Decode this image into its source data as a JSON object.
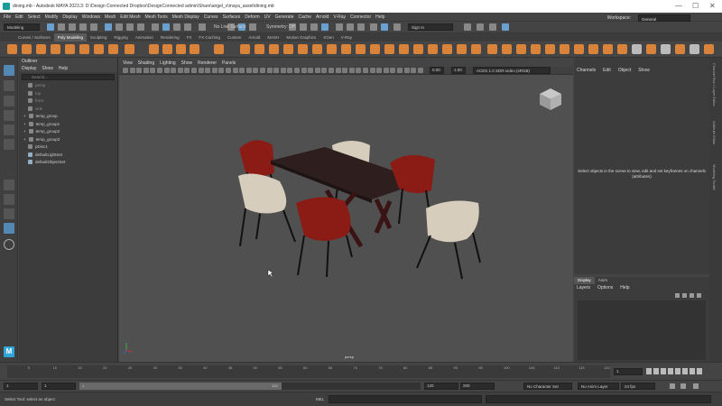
{
  "window": {
    "title": "dining.mb - Autodesk MAYA 2023.3: D:\\Design Connected Dropbox\\DesignConnected admin\\Share\\angel_v\\maya_asset\\dining.mb",
    "minimize": "—",
    "maximize": "☐",
    "close": "✕"
  },
  "menubar": {
    "items": [
      "File",
      "Edit",
      "Select",
      "Modify",
      "Display",
      "Windows",
      "Mesh",
      "Edit Mesh",
      "Mesh Tools",
      "Mesh Display",
      "Curves",
      "Surfaces",
      "Deform",
      "UV",
      "Generate",
      "Cache",
      "Arnold",
      "V-Ray",
      "Connector",
      "Help"
    ],
    "workspace_label": "Workspace:",
    "workspace_value": "General"
  },
  "statusline": {
    "mode": "Modeling",
    "live_surface": "No Live Surface",
    "symmetry": "Symmetry: Off",
    "sign_in": "Sign In"
  },
  "shelf": {
    "tabs": [
      "Curves / Surfaces",
      "Poly Modeling",
      "Sculpting",
      "Rigging",
      "Animation",
      "Rendering",
      "FX",
      "FX Caching",
      "Custom",
      "Arnold",
      "MASH",
      "Motion Graphics",
      "XGen",
      "V-Ray"
    ],
    "active_tab": "Poly Modeling"
  },
  "outliner": {
    "title": "Outliner",
    "menu": [
      "Display",
      "Show",
      "Help"
    ],
    "search_placeholder": "Search...",
    "items": [
      {
        "label": "persp",
        "dim": true
      },
      {
        "label": "top",
        "dim": true
      },
      {
        "label": "front",
        "dim": true
      },
      {
        "label": "side",
        "dim": true
      },
      {
        "label": "temp_group",
        "dim": false
      },
      {
        "label": "temp_group1",
        "dim": false
      },
      {
        "label": "temp_group2",
        "dim": false
      },
      {
        "label": "temp_group3",
        "dim": false
      },
      {
        "label": "pDisc1",
        "dim": false
      },
      {
        "label": "defaultLightSet",
        "dim": false
      },
      {
        "label": "defaultObjectSet",
        "dim": false
      }
    ]
  },
  "viewport": {
    "menu": [
      "View",
      "Shading",
      "Lighting",
      "Show",
      "Renderer",
      "Panels"
    ],
    "exposure": "0.00",
    "gamma": "1.00",
    "color_space": "ACES 1.0 SDR-video (sRGB)",
    "camera": "persp"
  },
  "channelbox": {
    "menu": [
      "Channels",
      "Edit",
      "Object",
      "Show"
    ],
    "message": "Select objects in the scene to view, edit and set keyframes on channels (attributes)"
  },
  "sidetabs": [
    "Channel Box / Layer Editor",
    "Attribute Editor",
    "Modeling Toolkit"
  ],
  "layers": {
    "tabs": [
      "Display",
      "Anim"
    ],
    "menu": [
      "Layers",
      "Options",
      "Help"
    ]
  },
  "timeslider": {
    "ticks": [
      "5",
      "10",
      "15",
      "20",
      "25",
      "30",
      "35",
      "40",
      "45",
      "50",
      "55",
      "60",
      "65",
      "70",
      "75",
      "80",
      "85",
      "90",
      "95",
      "100",
      "105",
      "110",
      "115",
      "120"
    ],
    "current_frame": "1"
  },
  "rangebar": {
    "start": "1",
    "inner_start": "1",
    "range_start_label": "1",
    "range_end_label": "120",
    "end": "120",
    "anim_end": "200",
    "character_set": "No Character Set",
    "anim_layer": "No Anim Layer",
    "fps": "24 fps"
  },
  "cmdline": {
    "help": "Select Tool: select an object",
    "lang": "MEL"
  },
  "colors": {
    "accent_orange": "#d9823a",
    "active_blue": "#5388b4",
    "maya_teal": "#1b9c9c",
    "chair_red": "#8a1c15",
    "chair_cream": "#d6cdbd",
    "table_dark": "#2e1e1e"
  }
}
